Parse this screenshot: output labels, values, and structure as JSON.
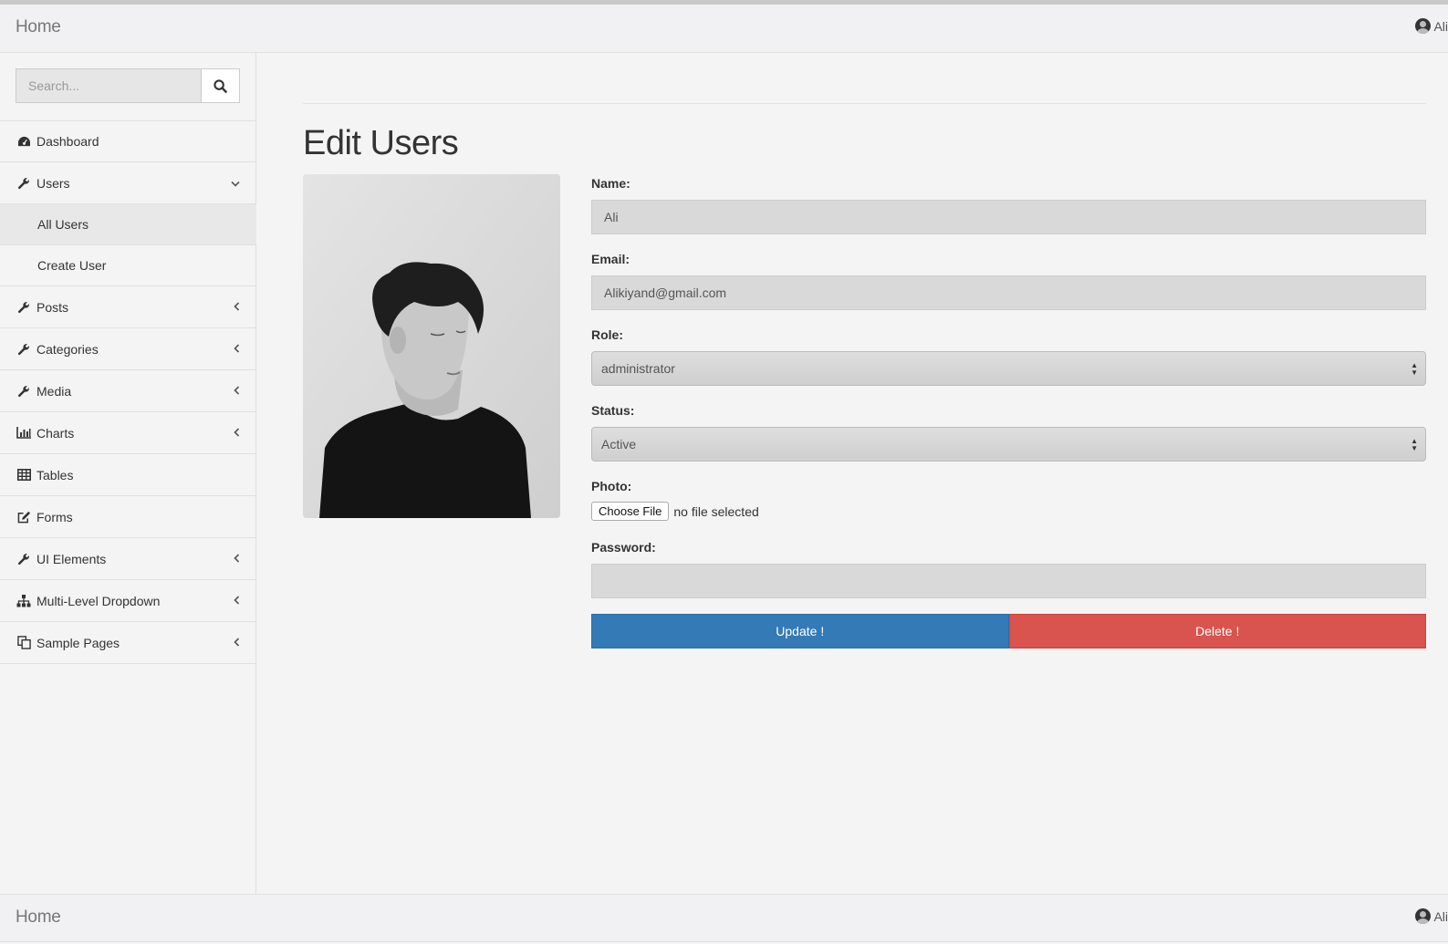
{
  "navbar": {
    "brand": "Home",
    "user_name": "Ali"
  },
  "footer": {
    "brand": "Home",
    "user_name": "Ali"
  },
  "search": {
    "placeholder": "Search..."
  },
  "sidebar": {
    "items": [
      {
        "label": "Dashboard",
        "icon": "dashboard-icon"
      },
      {
        "label": "Users",
        "icon": "wrench-icon",
        "expanded": true,
        "children": [
          {
            "label": "All Users",
            "active": true
          },
          {
            "label": "Create User"
          }
        ]
      },
      {
        "label": "Posts",
        "icon": "wrench-icon"
      },
      {
        "label": "Categories",
        "icon": "wrench-icon"
      },
      {
        "label": "Media",
        "icon": "wrench-icon"
      },
      {
        "label": "Charts",
        "icon": "bar-chart-icon"
      },
      {
        "label": "Tables",
        "icon": "table-icon"
      },
      {
        "label": "Forms",
        "icon": "edit-icon"
      },
      {
        "label": "UI Elements",
        "icon": "wrench-icon"
      },
      {
        "label": "Multi-Level Dropdown",
        "icon": "sitemap-icon"
      },
      {
        "label": "Sample Pages",
        "icon": "copy-icon"
      }
    ]
  },
  "page": {
    "title": "Edit Users",
    "form": {
      "name_label": "Name:",
      "name_value": "Ali",
      "email_label": "Email:",
      "email_value": "Alikiyand@gmail.com",
      "role_label": "Role:",
      "role_value": "administrator",
      "status_label": "Status:",
      "status_value": "Active",
      "photo_label": "Photo:",
      "choose_file": "Choose File",
      "no_file": "no file selected",
      "password_label": "Password:",
      "password_value": "",
      "update_button": "Update !",
      "delete_button": "Delete !"
    }
  },
  "colors": {
    "primary": "#337ab7",
    "danger": "#d9534f",
    "link": "#337ab7"
  }
}
